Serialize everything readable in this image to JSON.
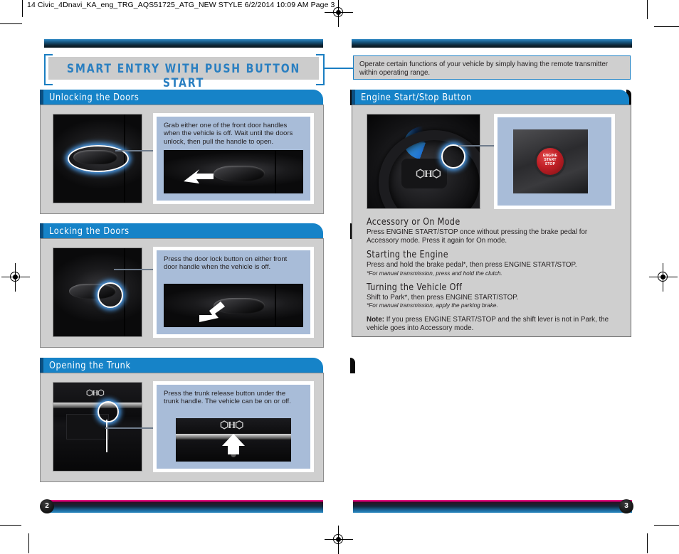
{
  "print_marks": {
    "slug": "14 Civic_4Dnavi_KA_eng_TRG_AQS51725_ATG_NEW STYLE  6/2/2014  10:09 AM  Page 3"
  },
  "title": {
    "heading": "SMART ENTRY WITH PUSH BUTTON START"
  },
  "intro_note": {
    "text": "Operate certain functions of your vehicle by simply having the remote transmitter within operating range."
  },
  "left_sections": [
    {
      "heading": "Unlocking the Doors",
      "caption": "Grab either one of the front door handles when the vehicle is off.  Wait until the doors unlock, then pull the handle to open."
    },
    {
      "heading": "Locking the Doors",
      "caption": "Press the door lock button on either front door handle when the vehicle is off."
    },
    {
      "heading": "Opening the Trunk",
      "caption": "Press the trunk release button under the trunk handle.  The vehicle can be on or off."
    }
  ],
  "right_section": {
    "heading": "Engine Start/Stop Button",
    "button_label_line1": "ENGINE",
    "button_label_line2": "START",
    "button_label_line3": "STOP",
    "blocks": [
      {
        "subhead": "Accessory or On Mode",
        "body": "Press ENGINE START/STOP once without pressing the brake pedal for Accessory mode. Press it again for On mode.",
        "footnote": ""
      },
      {
        "subhead": "Starting the Engine",
        "body": "Press and hold the brake pedal*,  then press ENGINE START/STOP.",
        "footnote": "*For manual transmission, press and hold the clutch."
      },
      {
        "subhead": "Turning the Vehicle Off",
        "body": "Shift to Park*, then press ENGINE START/STOP.",
        "footnote": "*For manual transmission, apply the parking brake."
      }
    ],
    "note_label": "Note:",
    "note_text": " If you press ENGINE START/STOP and the shift lever is not in Park, the vehicle goes into Accessory mode."
  },
  "footer": {
    "left_page": "2",
    "right_page": "3"
  },
  "colors": {
    "accent_blue": "#1a7ec2",
    "tab_blue": "#1683c8",
    "panel_grey": "#cfcfcf",
    "title_grey": "#cccccc",
    "caption_blue_grey": "#a8bcd8",
    "rail_magenta": "#e6007e"
  }
}
